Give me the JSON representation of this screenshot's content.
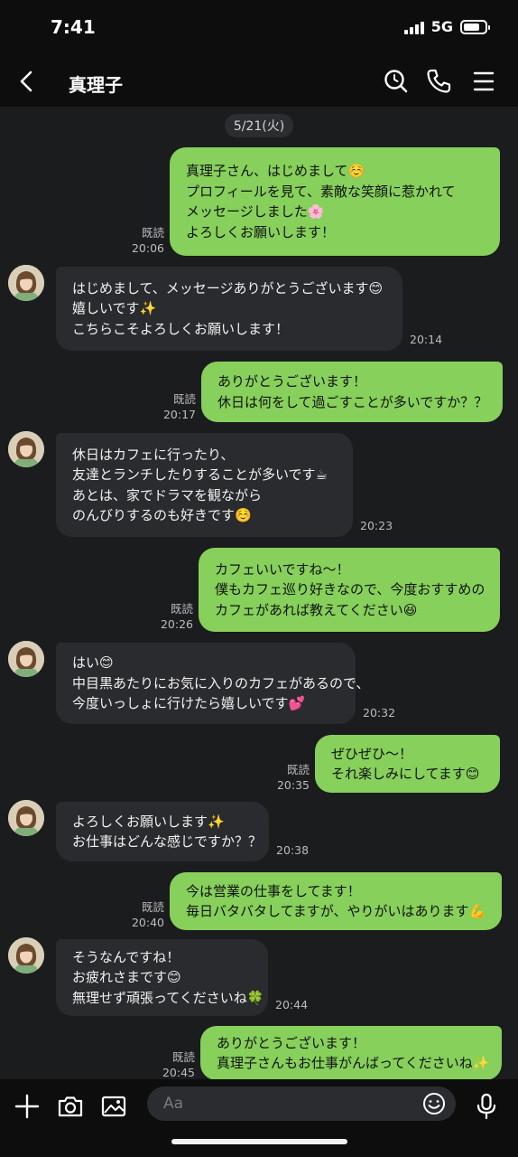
{
  "status_bar": {
    "time": "7:41",
    "network": "5G",
    "battery_level": 0.75
  },
  "header": {
    "title": "真理子",
    "icons": [
      "back-icon",
      "search-icon",
      "phone-icon",
      "menu-icon"
    ]
  },
  "chat": {
    "date_label": "5/21(火)",
    "read_label": "既読",
    "messages": [
      {
        "side": "out",
        "lines": [
          "真理子さん、はじめまして☺️",
          "プロフィールを見て、素敵な笑顔に惹かれて",
          "メッセージしました🌸",
          "よろしくお願いします！"
        ],
        "time": "20:06",
        "read": true
      },
      {
        "side": "in",
        "lines": [
          "はじめまして、メッセージありがとうございます😊",
          "嬉しいです✨",
          "こちらこそよろしくお願いします！"
        ],
        "time": "20:14"
      },
      {
        "side": "out",
        "lines": [
          "ありがとうございます！",
          "休日は何をして過ごすことが多いですか？？"
        ],
        "time": "20:17",
        "read": true
      },
      {
        "side": "in",
        "lines": [
          "休日はカフェに行ったり、",
          "友達とランチしたりすることが多いです☕",
          "あとは、家でドラマを観ながら",
          "のんびりするのも好きです☺️"
        ],
        "time": "20:23"
      },
      {
        "side": "out",
        "lines": [
          "カフェいいですね〜！",
          "僕もカフェ巡り好きなので、今度おすすめの",
          "カフェがあれば教えてください😆"
        ],
        "time": "20:26",
        "read": true
      },
      {
        "side": "in",
        "lines": [
          "はい😊",
          "中目黒あたりにお気に入りのカフェがあるので、",
          "今度いっしょに行けたら嬉しいです💕"
        ],
        "time": "20:32"
      },
      {
        "side": "out",
        "lines": [
          "ぜひぜひ〜！",
          "それ楽しみにしてます😊"
        ],
        "time": "20:35",
        "read": true
      },
      {
        "side": "in",
        "lines": [
          "よろしくお願いします✨",
          "お仕事はどんな感じですか？？"
        ],
        "time": "20:38"
      },
      {
        "side": "out",
        "lines": [
          "今は営業の仕事をしてます！",
          "毎日バタバタしてますが、やりがいはあります💪"
        ],
        "time": "20:40",
        "read": true
      },
      {
        "side": "in",
        "lines": [
          "そうなんですね！",
          "お疲れさまです😊",
          "無理せず頑張ってくださいね🍀"
        ],
        "time": "20:44"
      },
      {
        "side": "out",
        "lines": [
          "ありがとうございます！",
          "真理子さんもお仕事がんばってくださいね✨"
        ],
        "time": "20:45",
        "read": true
      }
    ]
  },
  "input_bar": {
    "placeholder": "Aa",
    "icons": [
      "plus-icon",
      "camera-icon",
      "image-icon",
      "emoji-icon",
      "microphone-icon"
    ]
  },
  "colors": {
    "outgoing_bubble": "#86d05b",
    "incoming_bubble": "#2a2b2e",
    "background": "#1b1c1e",
    "bar": "#0d0d0e"
  }
}
